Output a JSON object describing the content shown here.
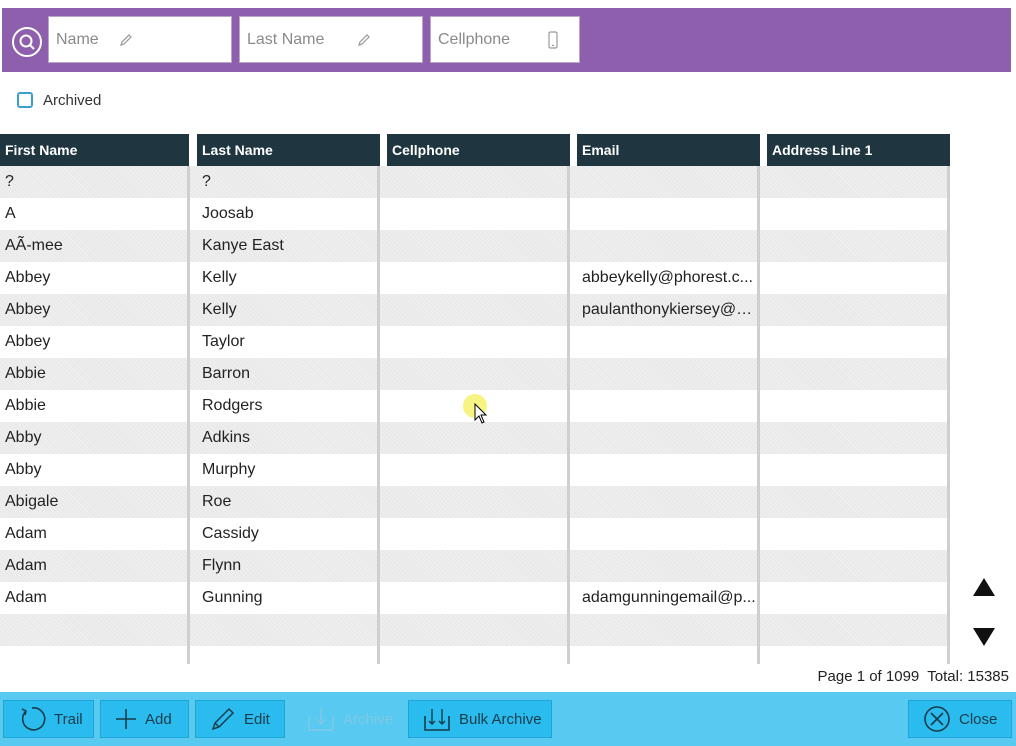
{
  "search": {
    "name_placeholder": "Name",
    "last_name_placeholder": "Last Name",
    "cellphone_placeholder": "Cellphone"
  },
  "filters": {
    "archived_label": "Archived",
    "archived_checked": false
  },
  "columns": [
    "First Name",
    "Last Name",
    "Cellphone",
    "Email",
    "Address Line 1"
  ],
  "rows": [
    [
      "?",
      "?",
      "",
      "",
      ""
    ],
    [
      "A",
      "Joosab",
      "",
      "",
      ""
    ],
    [
      "AÃ-mee",
      "Kanye East",
      "",
      "",
      ""
    ],
    [
      "Abbey",
      "Kelly",
      "",
      "abbeykelly@phorest.c...",
      ""
    ],
    [
      "Abbey",
      "Kelly",
      "",
      "paulanthonykiersey@g...",
      ""
    ],
    [
      "Abbey",
      "Taylor",
      "",
      "",
      ""
    ],
    [
      "Abbie",
      "Barron",
      "",
      "",
      ""
    ],
    [
      "Abbie",
      "Rodgers",
      "",
      "",
      ""
    ],
    [
      "Abby",
      "Adkins",
      "",
      "",
      ""
    ],
    [
      "Abby",
      "Murphy",
      "",
      "",
      ""
    ],
    [
      "Abigale",
      "Roe",
      "",
      "",
      ""
    ],
    [
      "Adam",
      "Cassidy",
      "",
      "",
      ""
    ],
    [
      "Adam",
      "Flynn",
      "",
      "",
      ""
    ],
    [
      "Adam",
      "Gunning",
      "",
      "adamgunningemail@p...",
      ""
    ],
    [
      "",
      "",
      "",
      "",
      ""
    ]
  ],
  "pager": {
    "page_text": "Page 1 of 1099",
    "total_text": "Total: 15385"
  },
  "toolbar": {
    "trail": "Trail",
    "add": "Add",
    "edit": "Edit",
    "archive": "Archive",
    "bulk_archive": "Bulk Archive",
    "close": "Close"
  },
  "colors": {
    "search_bar": "#8e5fad",
    "header": "#1f3641",
    "toolbar": "#58c9f0",
    "button": "#2bbcef"
  }
}
